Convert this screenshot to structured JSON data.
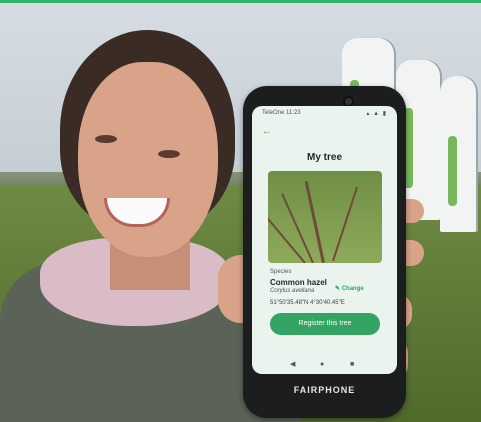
{
  "phone_app": {
    "status_bar": {
      "time": "11:23",
      "carrier": "TeleOne",
      "icons": "▴ ▲ ▮"
    },
    "back_icon": "arrow-left-icon",
    "title": "My tree",
    "species": {
      "label": "Species",
      "common_name": "Common hazel",
      "latin_name": "Corylus avellana",
      "coordinates": "51°50'35.48\"N 4°30'40.45\"E",
      "change_label": "✎ Change"
    },
    "register_button": "Register this tree",
    "nav": {
      "back": "◀",
      "home": "●",
      "recent": "■"
    }
  },
  "device_brand": "FAIRPHONE",
  "colors": {
    "accent_green": "#33a463",
    "screen_bg": "#eaf3ee"
  }
}
